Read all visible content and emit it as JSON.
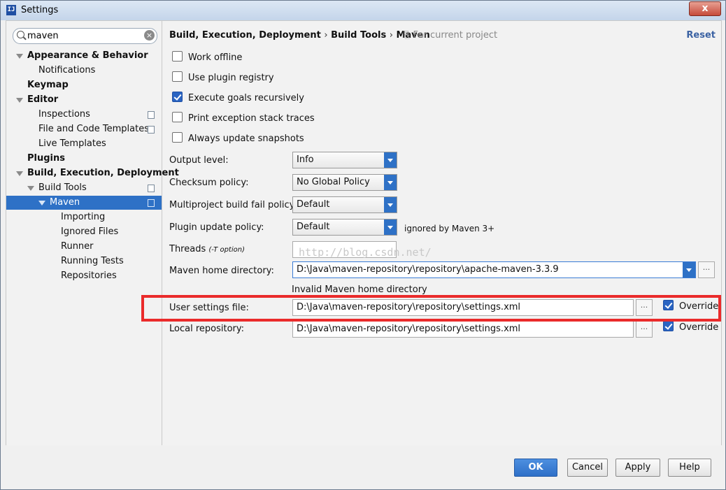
{
  "window": {
    "title": "Settings",
    "close_label": "x"
  },
  "search": {
    "value": "maven"
  },
  "sidebar": {
    "items": [
      {
        "label": "Appearance & Behavior"
      },
      {
        "label": "Notifications"
      },
      {
        "label": "Keymap"
      },
      {
        "label": "Editor"
      },
      {
        "label": "Inspections"
      },
      {
        "label": "File and Code Templates"
      },
      {
        "label": "Live Templates"
      },
      {
        "label": "Plugins"
      },
      {
        "label": "Build, Execution, Deployment"
      },
      {
        "label": "Build Tools"
      },
      {
        "label": "Maven"
      },
      {
        "label": "Importing"
      },
      {
        "label": "Ignored Files"
      },
      {
        "label": "Runner"
      },
      {
        "label": "Running Tests"
      },
      {
        "label": "Repositories"
      }
    ]
  },
  "header": {
    "crumbs": [
      "Build, Execution, Deployment",
      "Build Tools",
      "Maven"
    ],
    "separator": "›",
    "scope": "For current project",
    "reset_label": "Reset"
  },
  "options": [
    {
      "label": "Work offline",
      "checked": false
    },
    {
      "label": "Use plugin registry",
      "checked": false
    },
    {
      "label": "Execute goals recursively",
      "checked": true
    },
    {
      "label": "Print exception stack traces",
      "checked": false
    },
    {
      "label": "Always update snapshots",
      "checked": false
    }
  ],
  "fields": {
    "output_level": {
      "label": "Output level:",
      "value": "Info"
    },
    "checksum_policy": {
      "label": "Checksum policy:",
      "value": "No Global Policy"
    },
    "fail_policy": {
      "label": "Multiproject build fail policy:",
      "value": "Default"
    },
    "update_policy": {
      "label": "Plugin update policy:",
      "value": "Default",
      "hint": "ignored by Maven 3+"
    },
    "threads": {
      "label": "Threads",
      "note": "(-T option)",
      "value": ""
    },
    "maven_home": {
      "label": "Maven home directory:",
      "value": "D:\\Java\\maven-repository\\repository\\apache-maven-3.3.9",
      "error": "Invalid Maven home directory"
    },
    "user_settings": {
      "label": "User settings file:",
      "value": "D:\\Java\\maven-repository\\repository\\settings.xml",
      "override_label": "Override",
      "override": true
    },
    "local_repo": {
      "label": "Local repository:",
      "value": "D:\\Java\\maven-repository\\repository\\settings.xml",
      "override_label": "Override",
      "override": true
    }
  },
  "browse_label": "...",
  "watermark": "http://blog.csdn.net/",
  "buttons": {
    "ok": "OK",
    "cancel": "Cancel",
    "apply": "Apply",
    "help": "Help"
  }
}
